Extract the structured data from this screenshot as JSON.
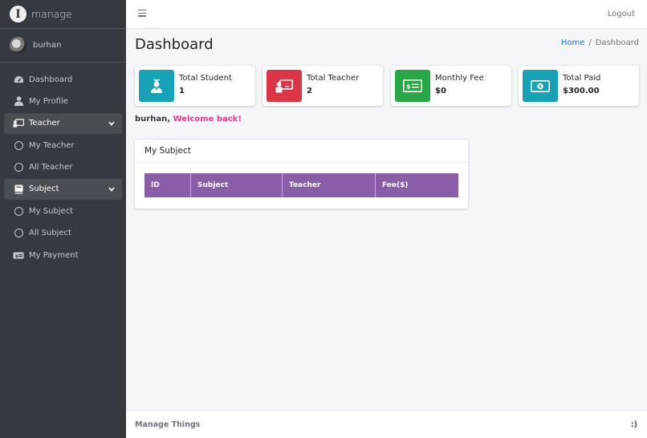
{
  "brand": {
    "logo_glyph": "I",
    "name": "manage"
  },
  "user": {
    "name": "burhan"
  },
  "sidebar": {
    "items": [
      {
        "label": "Dashboard",
        "icon": "tachometer-icon"
      },
      {
        "label": "My Profile",
        "icon": "user-icon"
      },
      {
        "label": "Teacher",
        "icon": "chalkboard-teacher-icon",
        "expanded": true
      },
      {
        "label": "My Teacher",
        "icon": "circle-icon"
      },
      {
        "label": "All Teacher",
        "icon": "circle-icon"
      },
      {
        "label": "Subject",
        "icon": "book-icon",
        "expanded": true
      },
      {
        "label": "My Subject",
        "icon": "circle-icon"
      },
      {
        "label": "All Subject",
        "icon": "circle-icon"
      },
      {
        "label": "My Payment",
        "icon": "money-bill-icon"
      }
    ]
  },
  "topbar": {
    "logout_label": "Logout"
  },
  "header": {
    "title": "Dashboard",
    "breadcrumb": {
      "home": "Home",
      "separator": "/",
      "current": "Dashboard"
    }
  },
  "stats": [
    {
      "label": "Total Student",
      "value": "1",
      "icon": "user-graduate-icon",
      "color": "#17a2b8"
    },
    {
      "label": "Total Teacher",
      "value": "2",
      "icon": "chalkboard-teacher-icon",
      "color": "#dc3545"
    },
    {
      "label": "Monthly Fee",
      "value": "$0",
      "icon": "money-check-icon",
      "color": "#28a745"
    },
    {
      "label": "Total Paid",
      "value": "$300.00",
      "icon": "money-bill-icon",
      "color": "#17a2b8"
    }
  ],
  "welcome": {
    "name": "burhan,",
    "message": "Welcome back!"
  },
  "subjects_card": {
    "title": "My Subject",
    "columns": [
      "ID",
      "Subject",
      "Teacher",
      "Fee($)"
    ],
    "rows": []
  },
  "footer": {
    "left": "Manage Things",
    "right": ":)"
  },
  "colors": {
    "sidebar_bg": "#343a40",
    "table_header": "#8a5da8",
    "accent": "#e83e8c",
    "link": "#007bff"
  }
}
